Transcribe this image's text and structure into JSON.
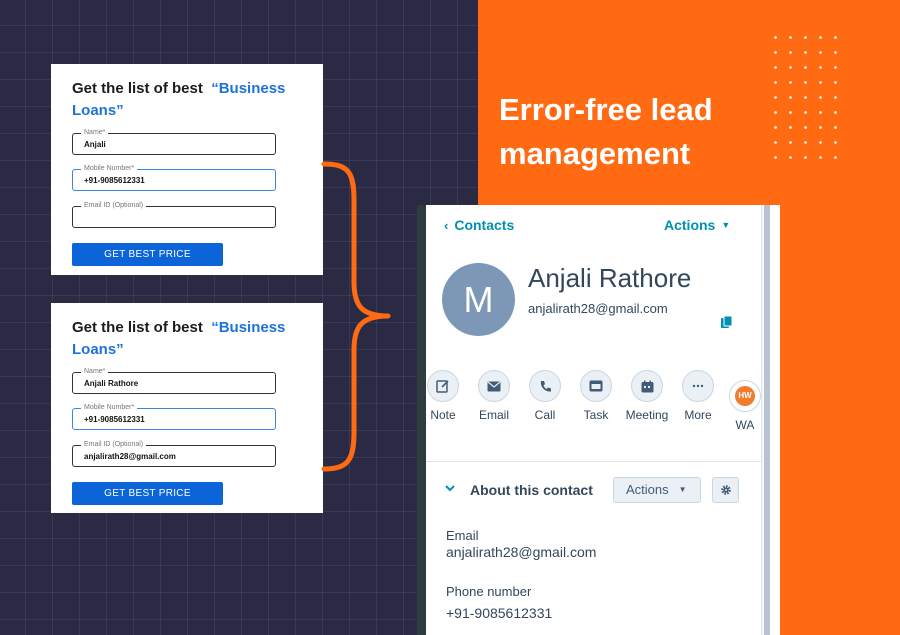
{
  "headline": "Error-free lead management",
  "forms": [
    {
      "title_prefix": "Get the list of best",
      "title_highlight": "“Business Loans”",
      "name_label": "Name*",
      "name_value": "Anjali",
      "mobile_label": "Mobile Number*",
      "mobile_value": "+91-9085612331",
      "email_label": "Email ID (Optional)",
      "email_value": "",
      "button": "GET BEST PRICE"
    },
    {
      "title_prefix": "Get the list of best",
      "title_highlight": "“Business Loans”",
      "name_label": "Name*",
      "name_value": "Anjali Rathore",
      "mobile_label": "Mobile Number*",
      "mobile_value": "+91-9085612331",
      "email_label": "Email ID (Optional)",
      "email_value": "anjalirath28@gmail.com",
      "button": "GET BEST PRICE"
    }
  ],
  "crm": {
    "back_link": "Contacts",
    "actions_label": "Actions",
    "avatar_initial": "M",
    "contact_name": "Anjali Rathore",
    "contact_email": "anjalirath28@gmail.com",
    "action_items": [
      {
        "label": "Note",
        "icon": "note-icon"
      },
      {
        "label": "Email",
        "icon": "email-icon"
      },
      {
        "label": "Call",
        "icon": "call-icon"
      },
      {
        "label": "Task",
        "icon": "task-icon"
      },
      {
        "label": "Meeting",
        "icon": "meeting-icon"
      },
      {
        "label": "More",
        "icon": "more-icon"
      },
      {
        "label": "WA",
        "icon": "whatsapp-icon",
        "badge": "HW"
      }
    ],
    "about_title": "About this contact",
    "about_actions": "Actions",
    "properties": [
      {
        "label": "Email",
        "value": "anjalirath28@gmail.com"
      },
      {
        "label": "Phone number",
        "value": "+91-9085612331"
      }
    ]
  },
  "colors": {
    "background": "#2b2a45",
    "orange": "#ff6a13",
    "link_blue": "#0091ae",
    "button_blue": "#0b64d8",
    "highlight_blue": "#1e73d9"
  }
}
